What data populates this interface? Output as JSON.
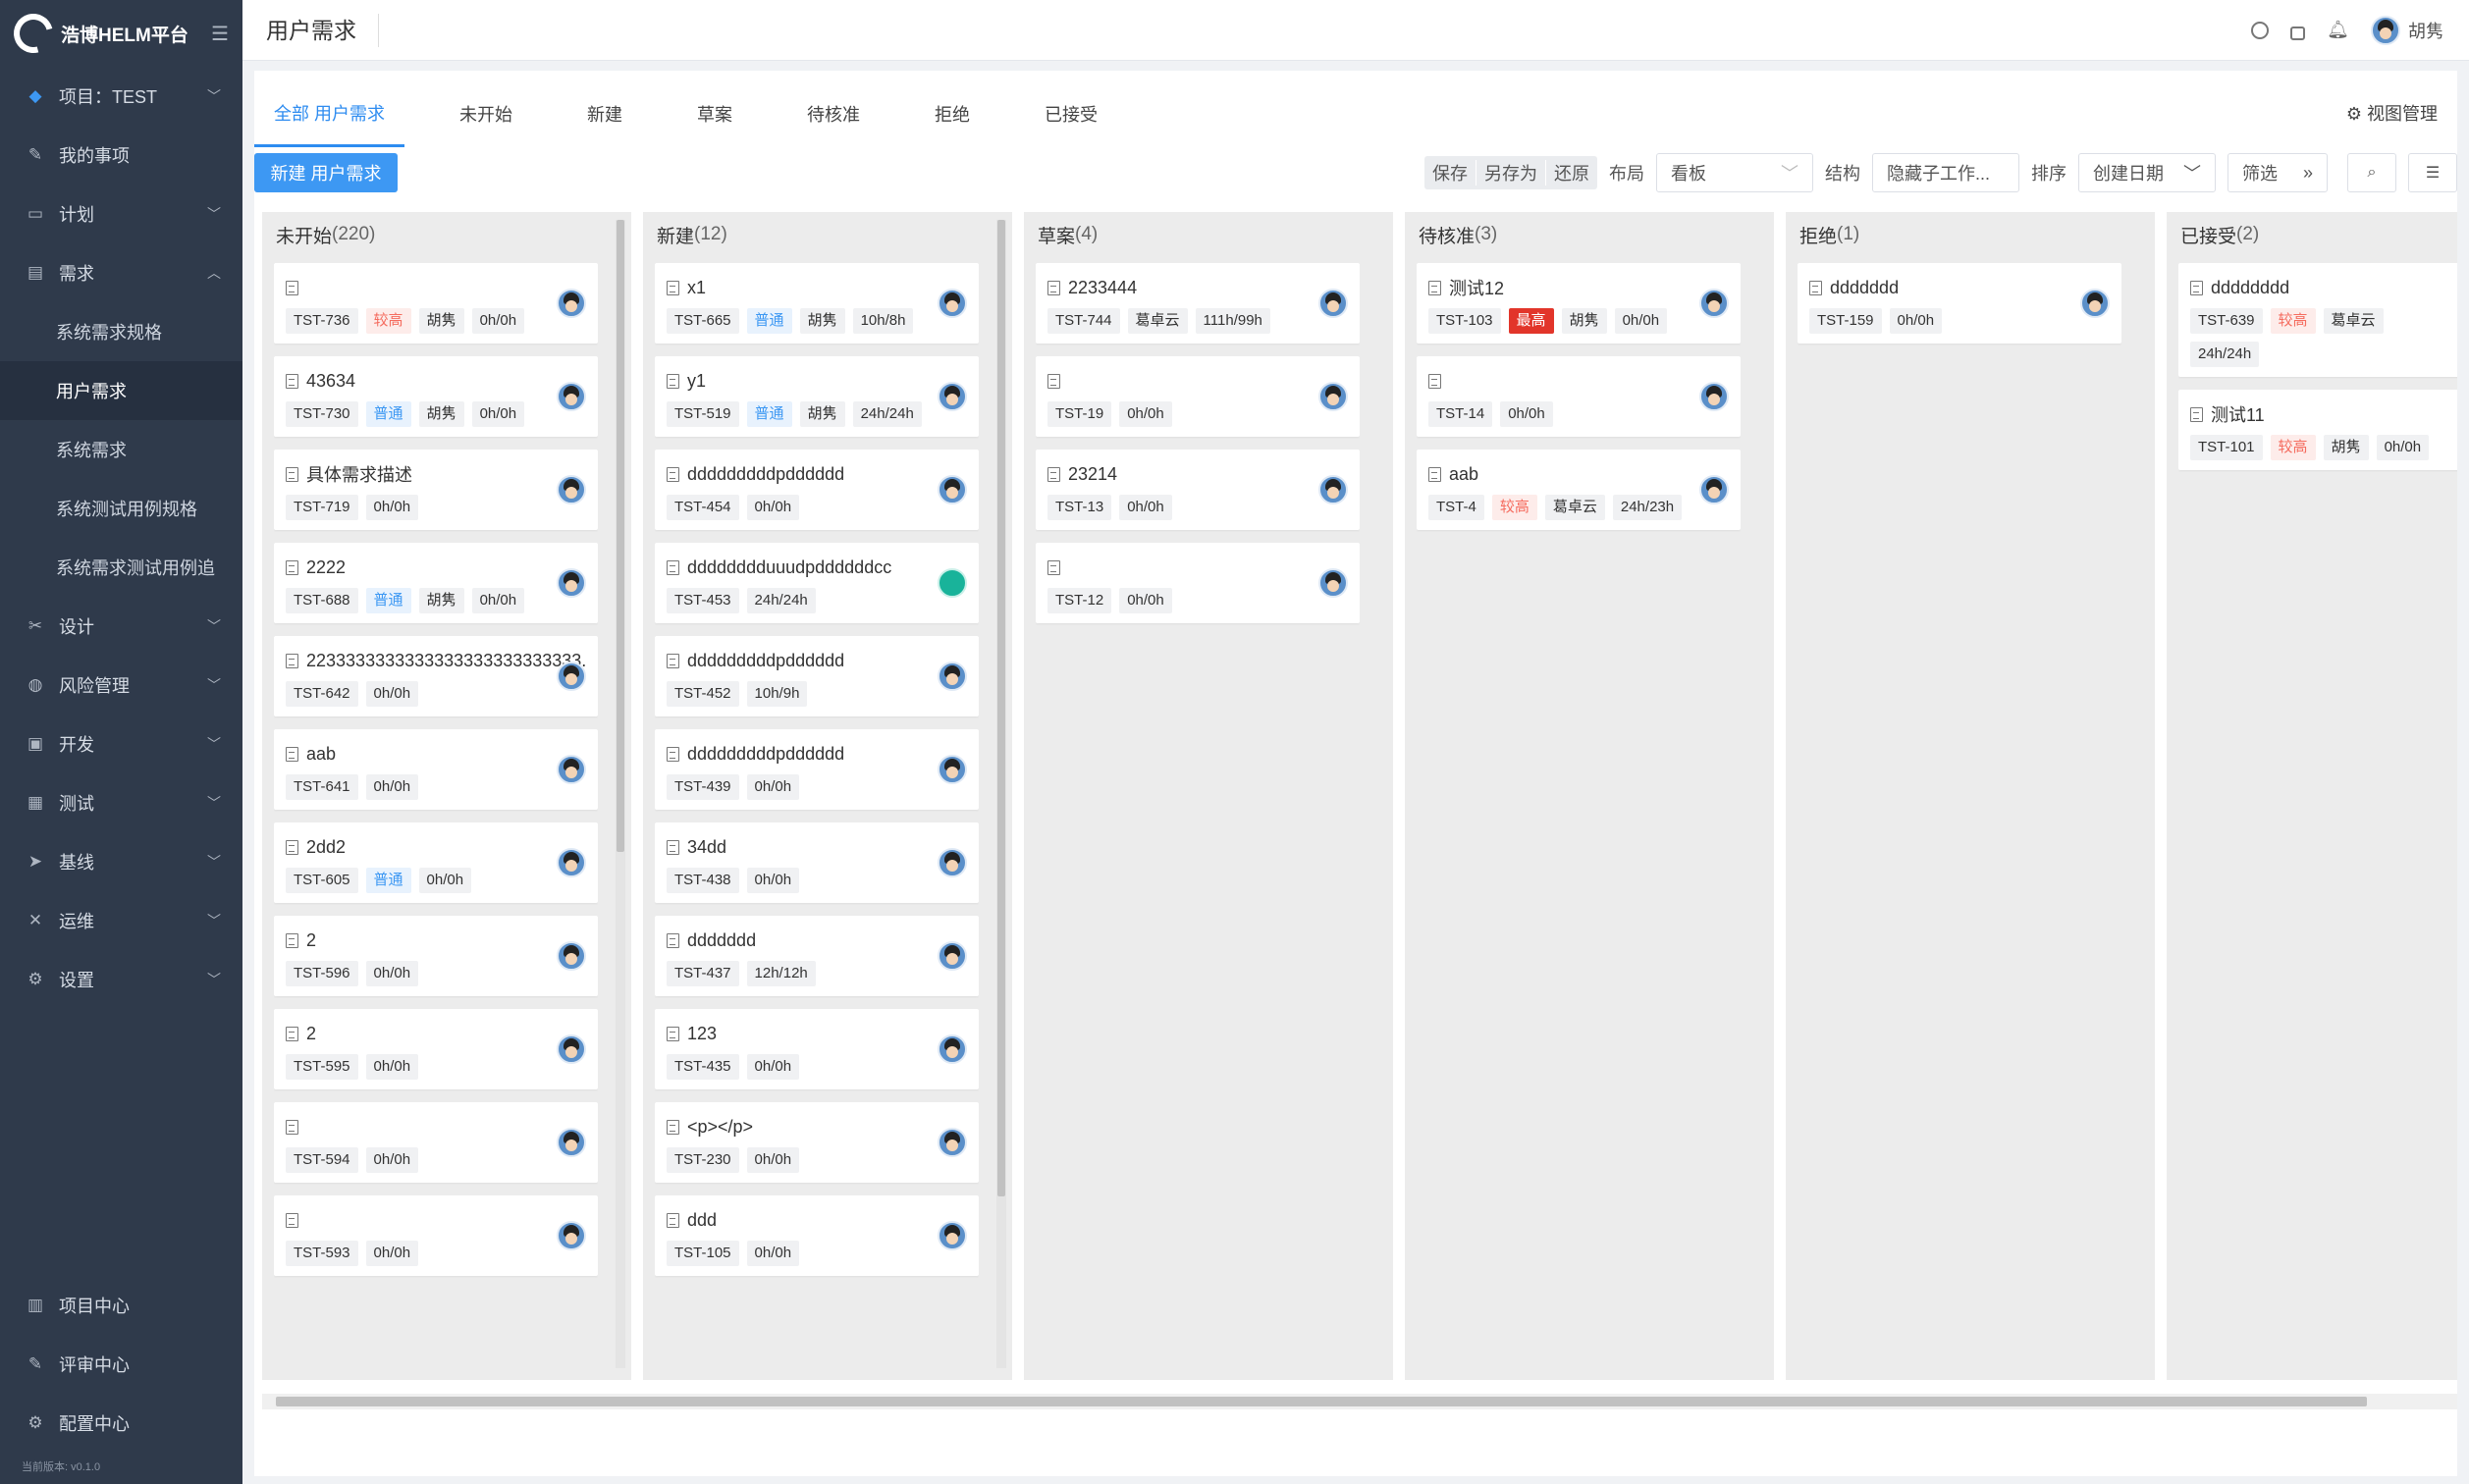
{
  "app": {
    "name": "浩博HELM平台"
  },
  "sidebar": {
    "project_label": "项目：TEST",
    "items": [
      {
        "label": "我的事项",
        "icon": "edit-icon",
        "glyph": "✎",
        "expandable": false
      },
      {
        "label": "计划",
        "icon": "plan-icon",
        "glyph": "▭",
        "expandable": true
      },
      {
        "label": "需求",
        "icon": "requirement-icon",
        "glyph": "▤",
        "expandable": true,
        "expanded": true
      }
    ],
    "sub_items": [
      {
        "label": "系统需求规格",
        "active": false
      },
      {
        "label": "用户需求",
        "active": true
      },
      {
        "label": "系统需求",
        "active": false
      },
      {
        "label": "系统测试用例规格",
        "active": false
      },
      {
        "label": "系统需求测试用例追",
        "active": false
      }
    ],
    "items2": [
      {
        "label": "设计",
        "icon": "design-icon",
        "glyph": "✂"
      },
      {
        "label": "风险管理",
        "icon": "shield-icon",
        "glyph": "◍"
      },
      {
        "label": "开发",
        "icon": "code-icon",
        "glyph": "▣"
      },
      {
        "label": "测试",
        "icon": "test-icon",
        "glyph": "▦"
      },
      {
        "label": "基线",
        "icon": "send-icon",
        "glyph": "➤"
      },
      {
        "label": "运维",
        "icon": "tools-icon",
        "glyph": "✕"
      },
      {
        "label": "设置",
        "icon": "gear-icon",
        "glyph": "⚙"
      }
    ],
    "bottom_items": [
      {
        "label": "项目中心",
        "icon": "project-center-icon",
        "glyph": "▥"
      },
      {
        "label": "评审中心",
        "icon": "review-icon",
        "glyph": "✎"
      },
      {
        "label": "配置中心",
        "icon": "config-icon",
        "glyph": "⚙"
      }
    ],
    "version": "当前版本: v0.1.0"
  },
  "topbar": {
    "title": "用户需求",
    "user_name": "胡隽"
  },
  "tabs": [
    {
      "label": "全部 用户需求",
      "active": true
    },
    {
      "label": "未开始"
    },
    {
      "label": "新建"
    },
    {
      "label": "草案"
    },
    {
      "label": "待核准"
    },
    {
      "label": "拒绝"
    },
    {
      "label": "已接受"
    }
  ],
  "view_manage": "视图管理",
  "toolbar": {
    "new_button": "新建 用户需求",
    "save": "保存",
    "save_as": "另存为",
    "restore": "还原",
    "layout_label": "布局",
    "layout_value": "看板",
    "structure_label": "结构",
    "structure_value": "隐藏子工作...",
    "sort_label": "排序",
    "sort_value": "创建日期",
    "filter": "筛选"
  },
  "columns": [
    {
      "name": "未开始",
      "count": "(220)",
      "scroll": {
        "top": 0.0,
        "size": 0.55
      },
      "cards": [
        {
          "title": "",
          "tags": [
            [
              "TST-736",
              ""
            ],
            [
              "较高",
              "high"
            ],
            [
              "胡隽",
              ""
            ],
            [
              "0h/0h",
              ""
            ]
          ]
        },
        {
          "title": "43634",
          "tags": [
            [
              "TST-730",
              ""
            ],
            [
              "普通",
              "normal"
            ],
            [
              "胡隽",
              ""
            ],
            [
              "0h/0h",
              ""
            ]
          ]
        },
        {
          "title": "具体需求描述",
          "tags": [
            [
              "TST-719",
              ""
            ],
            [
              "0h/0h",
              ""
            ]
          ]
        },
        {
          "title": "2222",
          "tags": [
            [
              "TST-688",
              ""
            ],
            [
              "普通",
              "normal"
            ],
            [
              "胡隽",
              ""
            ],
            [
              "0h/0h",
              ""
            ]
          ]
        },
        {
          "title": "2233333333333333333333333333...",
          "tags": [
            [
              "TST-642",
              ""
            ],
            [
              "0h/0h",
              ""
            ]
          ]
        },
        {
          "title": "aab",
          "tags": [
            [
              "TST-641",
              ""
            ],
            [
              "0h/0h",
              ""
            ]
          ]
        },
        {
          "title": "2dd2",
          "tags": [
            [
              "TST-605",
              ""
            ],
            [
              "普通",
              "normal"
            ],
            [
              "0h/0h",
              ""
            ]
          ]
        },
        {
          "title": "2",
          "tags": [
            [
              "TST-596",
              ""
            ],
            [
              "0h/0h",
              ""
            ]
          ]
        },
        {
          "title": "2",
          "tags": [
            [
              "TST-595",
              ""
            ],
            [
              "0h/0h",
              ""
            ]
          ]
        },
        {
          "title": "",
          "tags": [
            [
              "TST-594",
              ""
            ],
            [
              "0h/0h",
              ""
            ]
          ]
        },
        {
          "title": "",
          "tags": [
            [
              "TST-593",
              ""
            ],
            [
              "0h/0h",
              ""
            ]
          ]
        }
      ]
    },
    {
      "name": "新建",
      "count": "(12)",
      "scroll": {
        "top": 0.0,
        "size": 0.85
      },
      "cards": [
        {
          "title": "x1",
          "tags": [
            [
              "TST-665",
              ""
            ],
            [
              "普通",
              "normal"
            ],
            [
              "胡隽",
              ""
            ],
            [
              "10h/8h",
              ""
            ]
          ]
        },
        {
          "title": "y1",
          "tags": [
            [
              "TST-519",
              ""
            ],
            [
              "普通",
              "normal"
            ],
            [
              "胡隽",
              ""
            ],
            [
              "24h/24h",
              ""
            ]
          ]
        },
        {
          "title": "dddddddddpdddddd",
          "tags": [
            [
              "TST-454",
              ""
            ],
            [
              "0h/0h",
              ""
            ]
          ]
        },
        {
          "title": "dddddddduuudpddddddcc",
          "tags": [
            [
              "TST-453",
              ""
            ],
            [
              "24h/24h",
              ""
            ]
          ],
          "avatar": "green"
        },
        {
          "title": "dddddddddpdddddd",
          "tags": [
            [
              "TST-452",
              ""
            ],
            [
              "10h/9h",
              ""
            ]
          ]
        },
        {
          "title": "dddddddddpdddddd",
          "tags": [
            [
              "TST-439",
              ""
            ],
            [
              "0h/0h",
              ""
            ]
          ]
        },
        {
          "title": "34dd",
          "tags": [
            [
              "TST-438",
              ""
            ],
            [
              "0h/0h",
              ""
            ]
          ]
        },
        {
          "title": "ddddddd",
          "tags": [
            [
              "TST-437",
              ""
            ],
            [
              "12h/12h",
              ""
            ]
          ]
        },
        {
          "title": "123",
          "tags": [
            [
              "TST-435",
              ""
            ],
            [
              "0h/0h",
              ""
            ]
          ]
        },
        {
          "title": "<p></p>",
          "tags": [
            [
              "TST-230",
              ""
            ],
            [
              "0h/0h",
              ""
            ]
          ]
        },
        {
          "title": "ddd",
          "tags": [
            [
              "TST-105",
              ""
            ],
            [
              "0h/0h",
              ""
            ]
          ]
        }
      ]
    },
    {
      "name": "草案",
      "count": "(4)",
      "cards": [
        {
          "title": "2233444",
          "tags": [
            [
              "TST-744",
              ""
            ],
            [
              "葛卓云",
              ""
            ],
            [
              "111h/99h",
              ""
            ]
          ]
        },
        {
          "title": "",
          "tags": [
            [
              "TST-19",
              ""
            ],
            [
              "0h/0h",
              ""
            ]
          ]
        },
        {
          "title": "23214",
          "tags": [
            [
              "TST-13",
              ""
            ],
            [
              "0h/0h",
              ""
            ]
          ]
        },
        {
          "title": "",
          "tags": [
            [
              "TST-12",
              ""
            ],
            [
              "0h/0h",
              ""
            ]
          ]
        }
      ]
    },
    {
      "name": "待核准",
      "count": "(3)",
      "cards": [
        {
          "title": "测试12",
          "tags": [
            [
              "TST-103",
              ""
            ],
            [
              "最高",
              "top"
            ],
            [
              "胡隽",
              ""
            ],
            [
              "0h/0h",
              ""
            ]
          ]
        },
        {
          "title": "",
          "tags": [
            [
              "TST-14",
              ""
            ],
            [
              "0h/0h",
              ""
            ]
          ]
        },
        {
          "title": "aab",
          "tags": [
            [
              "TST-4",
              ""
            ],
            [
              "较高",
              "high"
            ],
            [
              "葛卓云",
              ""
            ],
            [
              "24h/23h",
              ""
            ]
          ]
        }
      ]
    },
    {
      "name": "拒绝",
      "count": "(1)",
      "cards": [
        {
          "title": "ddddddd",
          "tags": [
            [
              "TST-159",
              ""
            ],
            [
              "0h/0h",
              ""
            ]
          ]
        }
      ]
    },
    {
      "name": "已接受",
      "count": "(2)",
      "cards": [
        {
          "title": "dddddddd",
          "tags": [
            [
              "TST-639",
              ""
            ],
            [
              "较高",
              "high"
            ],
            [
              "葛卓云",
              ""
            ],
            [
              "24h/24h",
              ""
            ]
          ],
          "no_avatar": true
        },
        {
          "title": "测试11",
          "tags": [
            [
              "TST-101",
              ""
            ],
            [
              "较高",
              "high"
            ],
            [
              "胡隽",
              ""
            ],
            [
              "0h/0h",
              ""
            ]
          ],
          "no_avatar": true
        }
      ]
    }
  ],
  "colors": {
    "accent": "#3d98f3",
    "sidebar": "#2f3a4b",
    "high": "#f56c5f",
    "top": "#e2352a"
  }
}
